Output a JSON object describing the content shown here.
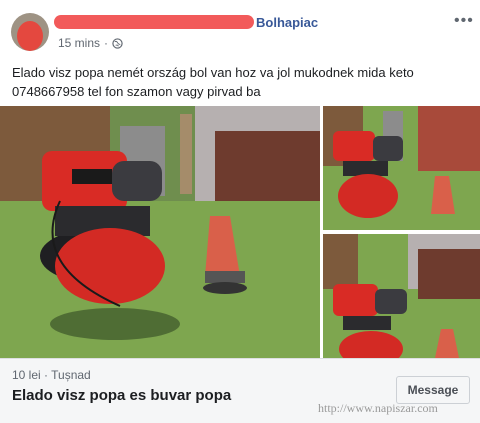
{
  "post": {
    "group_name": "Bolhapiac",
    "time": "15 mins",
    "more_label": "•••",
    "text": "Elado visz popa nemét ország bol van hoz va jol mukodnek mida keto 0748667958 tel fon szamon vagy pirvad ba"
  },
  "listing": {
    "price": "10 lei",
    "separator": " · ",
    "location": "Tușnad",
    "title": "Elado visz popa es buvar popa",
    "message_label": "Message"
  },
  "watermark": "http://www.napiszar.com",
  "icons": {
    "privacy": "globe-icon",
    "more": "more-dots-icon"
  },
  "colors": {
    "link": "#385898",
    "pump_red": "#d92b25",
    "grass": "#7ea64f"
  }
}
